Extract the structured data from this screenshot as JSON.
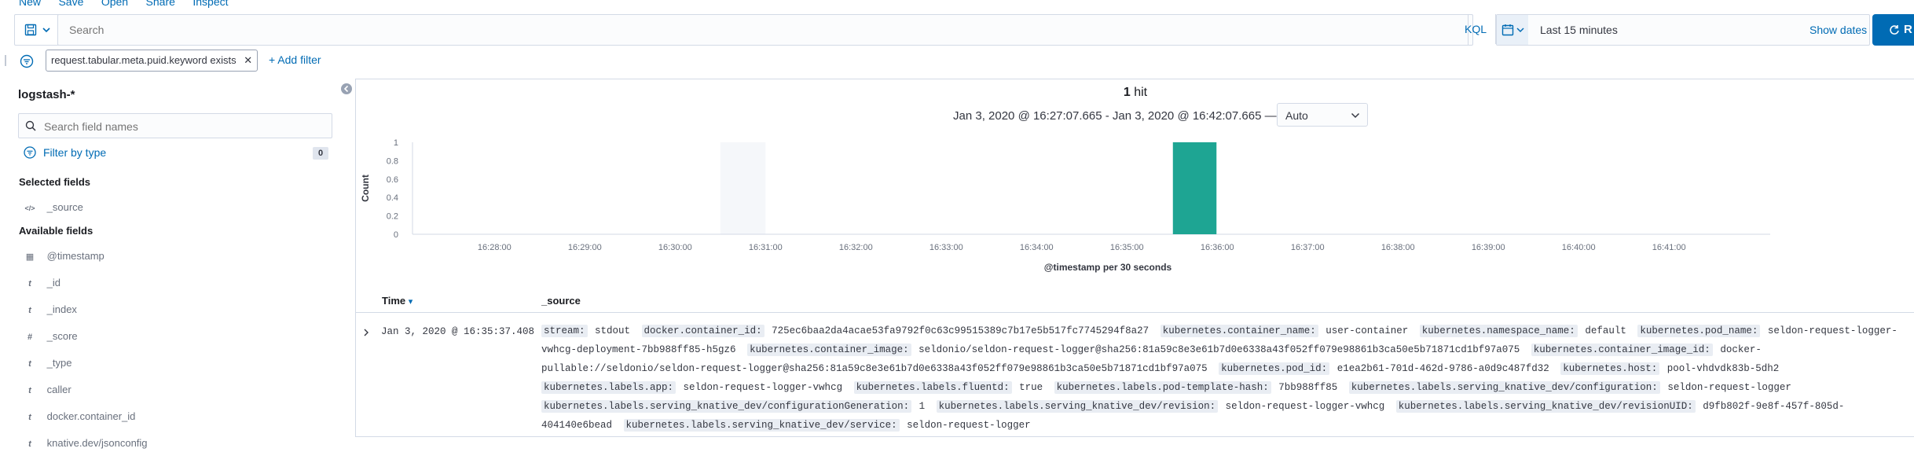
{
  "topnav": {
    "items": [
      "New",
      "Save",
      "Open",
      "Share",
      "Inspect"
    ]
  },
  "query": {
    "placeholder": "Search",
    "language": "KQL",
    "time_range_label": "Last 15 minutes",
    "show_dates": "Show dates",
    "refresh_label": "R"
  },
  "filters": {
    "active": [
      "request.tabular.meta.puid.keyword exists"
    ],
    "add_filter": "+ Add filter"
  },
  "sidebar": {
    "index_pattern": "logstash-*",
    "search_placeholder": "Search field names",
    "filter_by_type": "Filter by type",
    "filter_count": "0",
    "selected_title": "Selected fields",
    "selected_fields": [
      {
        "icon": "</>",
        "name": "_source"
      }
    ],
    "available_title": "Available fields",
    "available_fields": [
      {
        "icon": "▦",
        "name": "@timestamp"
      },
      {
        "icon": "t",
        "name": "_id"
      },
      {
        "icon": "t",
        "name": "_index"
      },
      {
        "icon": "#",
        "name": "_score"
      },
      {
        "icon": "t",
        "name": "_type"
      },
      {
        "icon": "t",
        "name": "caller"
      },
      {
        "icon": "t",
        "name": "docker.container_id"
      },
      {
        "icon": "t",
        "name": "knative.dev/jsonconfig"
      }
    ]
  },
  "results": {
    "hits_count": "1",
    "hits_label": "hit",
    "time_range": "Jan 3, 2020 @ 16:27:07.665 - Jan 3, 2020 @ 16:42:07.665 —",
    "interval": "Auto",
    "columns": {
      "time": "Time",
      "source": "_source"
    },
    "sort_indicator": "▾",
    "document": {
      "time": "Jan 3, 2020 @ 16:35:37.408",
      "fields": [
        {
          "k": "stream:",
          "v": "stdout"
        },
        {
          "k": "docker.container_id:",
          "v": "725ec6baa2da4acae53fa9792f0c63c99515389c7b17e5b517fc7745294f8a27"
        },
        {
          "k": "kubernetes.container_name:",
          "v": "user-container"
        },
        {
          "k": "kubernetes.namespace_name:",
          "v": "default"
        },
        {
          "k": "kubernetes.pod_name:",
          "v": "seldon-request-logger-vwhcg-deployment-7bb988ff85-h5gz6"
        },
        {
          "k": "kubernetes.container_image:",
          "v": "seldonio/seldon-request-logger@sha256:81a59c8e3e61b7d0e6338a43f052ff079e98861b3ca50e5b71871cd1bf97a075"
        },
        {
          "k": "kubernetes.container_image_id:",
          "v": "docker-pullable://seldonio/seldon-request-logger@sha256:81a59c8e3e61b7d0e6338a43f052ff079e98861b3ca50e5b71871cd1bf97a075"
        },
        {
          "k": "kubernetes.pod_id:",
          "v": "e1ea2b61-701d-462d-9786-a0d9c487fd32"
        },
        {
          "k": "kubernetes.host:",
          "v": "pool-vhdvdk83b-5dh2"
        },
        {
          "k": "kubernetes.labels.app:",
          "v": "seldon-request-logger-vwhcg"
        },
        {
          "k": "kubernetes.labels.fluentd:",
          "v": "true"
        },
        {
          "k": "kubernetes.labels.pod-template-hash:",
          "v": "7bb988ff85"
        },
        {
          "k": "kubernetes.labels.serving_knative_dev/configuration:",
          "v": "seldon-request-logger"
        },
        {
          "k": "kubernetes.labels.serving_knative_dev/configurationGeneration:",
          "v": "1"
        },
        {
          "k": "kubernetes.labels.serving_knative_dev/revision:",
          "v": "seldon-request-logger-vwhcg"
        },
        {
          "k": "kubernetes.labels.serving_knative_dev/revisionUID:",
          "v": "d9fb802f-9e8f-457f-805d-404140e6bead"
        },
        {
          "k": "kubernetes.labels.serving_knative_dev/service:",
          "v": "seldon-request-logger"
        }
      ]
    }
  },
  "chart_data": {
    "type": "bar",
    "ylabel": "Count",
    "xlabel": "@timestamp per 30 seconds",
    "yticks": [
      "0",
      "0.2",
      "0.4",
      "0.6",
      "0.8",
      "1"
    ],
    "ylim": [
      0,
      1
    ],
    "xticks": [
      "16:28:00",
      "16:29:00",
      "16:30:00",
      "16:31:00",
      "16:32:00",
      "16:33:00",
      "16:34:00",
      "16:35:00",
      "16:36:00",
      "16:37:00",
      "16:38:00",
      "16:39:00",
      "16:40:00",
      "16:41:00"
    ],
    "x_start_minutes": 27.11,
    "x_end_minutes": 42.12,
    "bars": [
      {
        "start": "16:35:30",
        "end": "16:36:00",
        "value": 1
      }
    ],
    "highlight": {
      "start": "16:30:30",
      "end": "16:31:00"
    },
    "bar_color": "#1ea593",
    "highlight_color": "#f5f7fa",
    "grid": false
  },
  "colors": {
    "accent": "#006bb4",
    "bar": "#1ea593"
  }
}
